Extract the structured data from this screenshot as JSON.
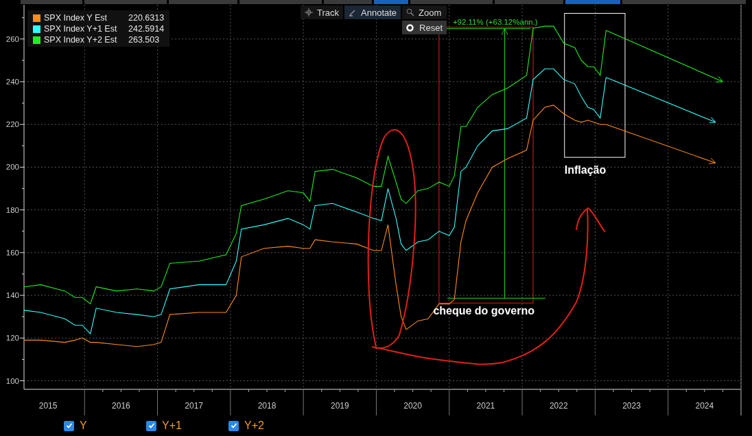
{
  "legend": [
    {
      "value": "220.6313"
    },
    {
      "value": "242.5914"
    },
    {
      "value": "263.503"
    }
  ],
  "toolbar": [
    {
      "label": "Track",
      "kind": "track",
      "selected": false
    },
    {
      "label": "Annotate",
      "kind": "annotate",
      "selected": true
    },
    {
      "label": "Zoom",
      "kind": "zoom",
      "selected": false
    }
  ],
  "reset_button": {
    "label": "Reset"
  },
  "chart_data": {
    "type": "line",
    "grid": true,
    "xlim": [
      2015.17,
      2025
    ],
    "ylim": [
      96,
      276
    ],
    "yticks": [
      100,
      120,
      140,
      160,
      180,
      200,
      220,
      240,
      260
    ],
    "xticks": [
      {
        "value": 2015.5,
        "label": "2015"
      },
      {
        "value": 2016.5,
        "label": "2016"
      },
      {
        "value": 2017.5,
        "label": "2017"
      },
      {
        "value": 2018.5,
        "label": "2018"
      },
      {
        "value": 2019.5,
        "label": "2019"
      },
      {
        "value": 2020.5,
        "label": "2020"
      },
      {
        "value": 2021.5,
        "label": "2021"
      },
      {
        "value": 2022.5,
        "label": "2022"
      },
      {
        "value": 2023.5,
        "label": "2023"
      },
      {
        "value": 2024.5,
        "label": "2024"
      }
    ],
    "x": [
      2015.17,
      2015.4,
      2015.73,
      2015.87,
      2015.97,
      2016.08,
      2016.16,
      2016.44,
      2016.72,
      2016.95,
      2017.05,
      2017.17,
      2017.57,
      2017.94,
      2018.08,
      2018.15,
      2018.46,
      2018.79,
      2019.0,
      2019.09,
      2019.16,
      2019.4,
      2019.73,
      2019.96,
      2020.07,
      2020.16,
      2020.27,
      2020.34,
      2020.41,
      2020.57,
      2020.71,
      2020.86,
      2021.0,
      2021.07,
      2021.16,
      2021.23,
      2021.39,
      2021.59,
      2021.8,
      2022.06,
      2022.15,
      2022.31,
      2022.43,
      2022.57,
      2022.72,
      2022.81,
      2022.9,
      2022.98,
      2023.07,
      2023.15
    ],
    "series": [
      {
        "name": "SPX Index Y Est",
        "color": "#ff8c1a",
        "values": [
          119,
          119,
          118,
          119,
          120,
          118,
          118,
          117,
          116,
          117,
          118,
          131,
          132,
          132,
          140,
          158,
          162,
          163,
          162,
          162,
          166,
          165,
          164,
          161,
          161,
          173,
          145,
          130,
          124,
          128,
          129,
          136,
          136,
          138,
          165,
          175,
          188,
          200,
          204,
          208,
          222,
          228,
          229,
          225,
          222,
          221,
          222,
          221,
          220,
          220
        ]
      },
      {
        "name": "SPX Index Y+1 Est",
        "color": "#33ffff",
        "values": [
          133,
          132,
          129,
          126,
          126,
          122,
          134,
          132,
          131,
          130,
          131,
          143,
          145,
          145,
          156,
          171,
          173,
          176,
          173,
          171,
          182,
          183,
          179,
          176,
          175,
          190,
          176,
          164,
          161,
          165,
          166,
          170,
          168,
          172,
          198,
          200,
          210,
          217,
          218,
          223,
          241,
          246,
          246,
          241,
          239,
          233,
          228,
          227,
          223,
          242
        ]
      },
      {
        "name": "SPX Index Y+2 Est",
        "color": "#22ee22",
        "values": [
          144,
          145,
          142,
          139,
          139,
          136,
          144,
          142,
          143,
          142,
          144,
          155,
          156,
          159,
          169,
          182,
          185,
          189,
          188,
          184,
          198,
          199,
          195,
          191,
          191,
          205,
          193,
          185,
          183,
          189,
          190,
          193,
          191,
          196,
          219,
          219,
          228,
          234,
          237,
          243,
          265,
          266,
          266,
          258,
          256,
          250,
          247,
          247,
          243,
          264
        ]
      }
    ],
    "annotations": [
      "+92.11% (+63.12%ann.)",
      "Inflação",
      "cheque do governo"
    ]
  },
  "checks": [
    {
      "label": "Y",
      "checked": true
    },
    {
      "label": "Y+1",
      "checked": true
    },
    {
      "label": "Y+2",
      "checked": true
    }
  ]
}
